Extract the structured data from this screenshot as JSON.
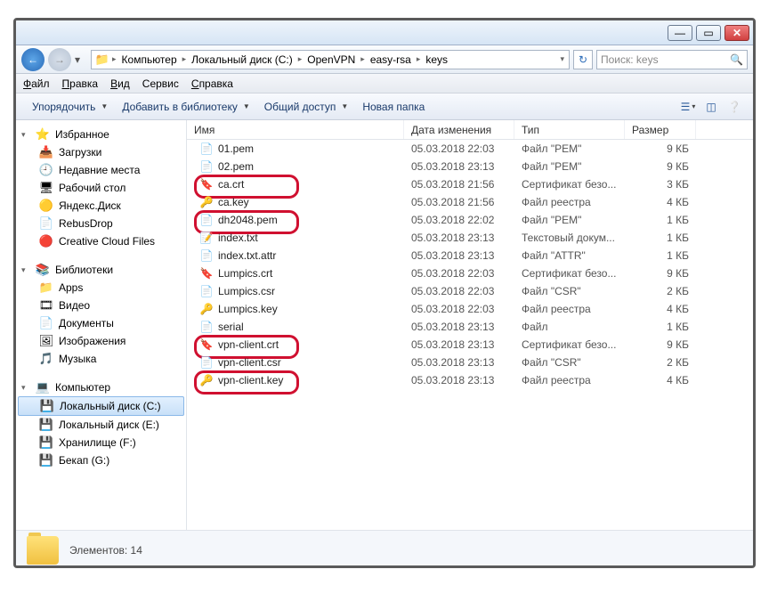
{
  "breadcrumb": [
    "Компьютер",
    "Локальный диск (C:)",
    "OpenVPN",
    "easy-rsa",
    "keys"
  ],
  "search": {
    "placeholder": "Поиск: keys"
  },
  "menu": {
    "file": "Файл",
    "edit": "Правка",
    "view": "Вид",
    "service": "Сервис",
    "help": "Справка"
  },
  "toolbar": {
    "organize": "Упорядочить",
    "addlib": "Добавить в библиотеку",
    "share": "Общий доступ",
    "newfolder": "Новая папка"
  },
  "columns": {
    "name": "Имя",
    "date": "Дата изменения",
    "type": "Тип",
    "size": "Размер"
  },
  "sidebar": {
    "favorites": "Избранное",
    "fav_items": [
      "Загрузки",
      "Недавние места",
      "Рабочий стол",
      "Яндекс.Диск",
      "RebusDrop",
      "Creative Cloud Files"
    ],
    "libraries": "Библиотеки",
    "lib_items": [
      "Apps",
      "Видео",
      "Документы",
      "Изображения",
      "Музыка"
    ],
    "computer": "Компьютер",
    "comp_items": [
      "Локальный диск (C:)",
      "Локальный диск (E:)",
      "Хранилище (F:)",
      "Бекап (G:)"
    ]
  },
  "files": [
    {
      "name": "01.pem",
      "date": "05.03.2018 22:03",
      "type": "Файл \"PEM\"",
      "size": "9 КБ",
      "icon": "file",
      "hl": false
    },
    {
      "name": "02.pem",
      "date": "05.03.2018 23:13",
      "type": "Файл \"PEM\"",
      "size": "9 КБ",
      "icon": "file",
      "hl": false
    },
    {
      "name": "ca.crt",
      "date": "05.03.2018 21:56",
      "type": "Сертификат безо...",
      "size": "3 КБ",
      "icon": "cert",
      "hl": true
    },
    {
      "name": "ca.key",
      "date": "05.03.2018 21:56",
      "type": "Файл реестра",
      "size": "4 КБ",
      "icon": "key",
      "hl": false
    },
    {
      "name": "dh2048.pem",
      "date": "05.03.2018 22:02",
      "type": "Файл \"PEM\"",
      "size": "1 КБ",
      "icon": "file",
      "hl": true
    },
    {
      "name": "index.txt",
      "date": "05.03.2018 23:13",
      "type": "Текстовый докум...",
      "size": "1 КБ",
      "icon": "txt",
      "hl": false
    },
    {
      "name": "index.txt.attr",
      "date": "05.03.2018 23:13",
      "type": "Файл \"ATTR\"",
      "size": "1 КБ",
      "icon": "file",
      "hl": false
    },
    {
      "name": "Lumpics.crt",
      "date": "05.03.2018 22:03",
      "type": "Сертификат безо...",
      "size": "9 КБ",
      "icon": "cert",
      "hl": false
    },
    {
      "name": "Lumpics.csr",
      "date": "05.03.2018 22:03",
      "type": "Файл \"CSR\"",
      "size": "2 КБ",
      "icon": "file",
      "hl": false
    },
    {
      "name": "Lumpics.key",
      "date": "05.03.2018 22:03",
      "type": "Файл реестра",
      "size": "4 КБ",
      "icon": "key",
      "hl": false
    },
    {
      "name": "serial",
      "date": "05.03.2018 23:13",
      "type": "Файл",
      "size": "1 КБ",
      "icon": "file",
      "hl": false
    },
    {
      "name": "vpn-client.crt",
      "date": "05.03.2018 23:13",
      "type": "Сертификат безо...",
      "size": "9 КБ",
      "icon": "cert",
      "hl": true
    },
    {
      "name": "vpn-client.csr",
      "date": "05.03.2018 23:13",
      "type": "Файл \"CSR\"",
      "size": "2 КБ",
      "icon": "file",
      "hl": false
    },
    {
      "name": "vpn-client.key",
      "date": "05.03.2018 23:13",
      "type": "Файл реестра",
      "size": "4 КБ",
      "icon": "key",
      "hl": true
    }
  ],
  "status": {
    "text": "Элементов: 14"
  },
  "icons": {
    "fav": "⭐",
    "dl": "📥",
    "recent": "🕘",
    "desktop": "🖥",
    "yadisk": "🟡",
    "rebus": "📄",
    "cc": "🔴",
    "lib": "📚",
    "apps": "📁",
    "video": "🎞",
    "docs": "📄",
    "img": "🖼",
    "music": "🎵",
    "comp": "💻",
    "drive": "💾",
    "file": "📄",
    "cert": "🔖",
    "key": "🔑",
    "txt": "📝",
    "folder": "📁"
  }
}
